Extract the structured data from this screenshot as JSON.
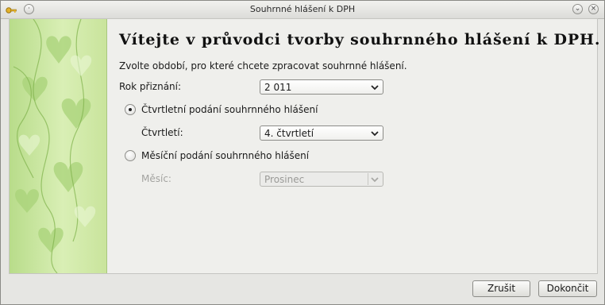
{
  "window": {
    "title": "Souhrnné hlášení k DPH",
    "icons": [
      "app-key-icon",
      "shade-icon",
      "minimize-icon",
      "close-icon"
    ]
  },
  "wizard": {
    "heading": "Vítejte v průvodci tvorby souhrnného hlášení k DPH.",
    "intro": "Zvolte období, pro které chcete zpracovat souhrnné hlášení.",
    "year": {
      "label": "Rok přiznání:",
      "value": "2 011"
    },
    "quarterly": {
      "radio_label": "Čtvrtletní podání souhrnného hlášení",
      "selected": true,
      "field_label": "Čtvrtletí:",
      "value": "4. čtvrtletí"
    },
    "monthly": {
      "radio_label": "Měsíční podání souhrnného hlášení",
      "selected": false,
      "field_label": "Měsíc:",
      "value": "Prosinec",
      "disabled": true
    }
  },
  "buttons": {
    "cancel": "Zrušit",
    "finish": "Dokončit"
  },
  "colors": {
    "side_panel": "#c6e59a",
    "background": "#efefec"
  }
}
